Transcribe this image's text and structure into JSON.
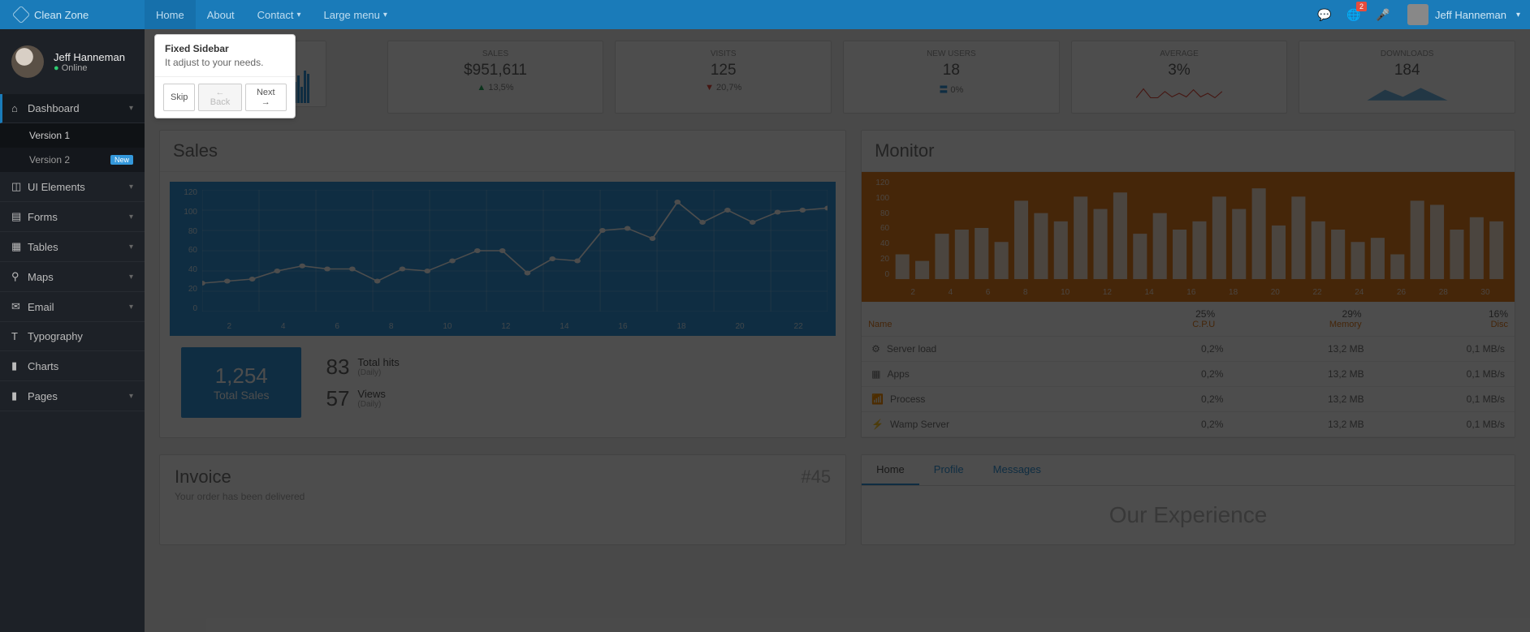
{
  "brand": "Clean Zone",
  "topnav": {
    "home": "Home",
    "about": "About",
    "contact": "Contact",
    "large": "Large menu"
  },
  "topbar": {
    "notif_badge": "2",
    "user": "Jeff Hanneman"
  },
  "profile": {
    "name": "Jeff Hanneman",
    "status": "Online"
  },
  "sidebar": {
    "dashboard": "Dashboard",
    "v1": "Version 1",
    "v2": "Version 2",
    "new": "New",
    "ui": "UI Elements",
    "forms": "Forms",
    "tables": "Tables",
    "maps": "Maps",
    "email": "Email",
    "typo": "Typography",
    "charts": "Charts",
    "pages": "Pages"
  },
  "popover": {
    "title": "Fixed Sidebar",
    "text": "It adjust to your needs.",
    "skip": "Skip",
    "back": "← Back",
    "next": "Next →"
  },
  "cards": {
    "sales": {
      "t": "SALES",
      "v": "$951,611",
      "d": "13,5%"
    },
    "visits": {
      "t": "VISITS",
      "v": "125",
      "d": "20,7%"
    },
    "users": {
      "t": "NEW USERS",
      "v": "18",
      "d": "0%"
    },
    "avg": {
      "t": "AVERAGE",
      "v": "3%"
    },
    "dl": {
      "t": "DOWNLOADS",
      "v": "184"
    }
  },
  "sales_panel": {
    "title": "Sales",
    "total_v": "1,254",
    "total_l": "Total Sales",
    "hits_v": "83",
    "hits_l": "Total hits",
    "hits_s": "(Daily)",
    "views_v": "57",
    "views_l": "Views",
    "views_s": "(Daily)"
  },
  "monitor_panel": {
    "title": "Monitor",
    "head": {
      "name": "Name",
      "cpu": "25%",
      "cpu_l": "C.P.U",
      "mem": "29%",
      "mem_l": "Memory",
      "disc": "16%",
      "disc_l": "Disc"
    },
    "rows": [
      {
        "n": "Server load",
        "c": "0,2%",
        "m": "13,2 MB",
        "d": "0,1 MB/s"
      },
      {
        "n": "Apps",
        "c": "0,2%",
        "m": "13,2 MB",
        "d": "0,1 MB/s"
      },
      {
        "n": "Process",
        "c": "0,2%",
        "m": "13,2 MB",
        "d": "0,1 MB/s"
      },
      {
        "n": "Wamp Server",
        "c": "0,2%",
        "m": "13,2 MB",
        "d": "0,1 MB/s"
      }
    ]
  },
  "invoice": {
    "title": "Invoice",
    "num": "#45",
    "sub": "Your order has been delivered"
  },
  "tabs": {
    "home": "Home",
    "profile": "Profile",
    "messages": "Messages",
    "exp": "Our Experience"
  },
  "chart_data": [
    {
      "type": "line",
      "title": "Sales",
      "x": [
        1,
        2,
        3,
        4,
        5,
        6,
        7,
        8,
        9,
        10,
        11,
        12,
        13,
        14,
        15,
        16,
        17,
        18,
        19,
        20,
        21,
        22,
        23
      ],
      "values": [
        28,
        30,
        32,
        40,
        45,
        42,
        42,
        30,
        42,
        40,
        50,
        60,
        60,
        38,
        52,
        50,
        80,
        82,
        72,
        108,
        88,
        100,
        88,
        98,
        100,
        102
      ],
      "ylim": [
        0,
        120
      ]
    },
    {
      "type": "bar",
      "title": "Monitor",
      "x": [
        1,
        2,
        3,
        4,
        5,
        6,
        7,
        8,
        9,
        10,
        11,
        12,
        13,
        14,
        15,
        16,
        17,
        18,
        19,
        20,
        21,
        22,
        23,
        24,
        25,
        26,
        27,
        28,
        29,
        30,
        31
      ],
      "values": [
        30,
        22,
        55,
        60,
        62,
        45,
        95,
        80,
        70,
        100,
        85,
        105,
        55,
        80,
        60,
        70,
        100,
        85,
        110,
        65,
        100,
        70,
        60,
        45,
        50,
        30,
        95,
        90,
        60,
        75,
        70
      ],
      "ylim": [
        0,
        120
      ]
    }
  ]
}
